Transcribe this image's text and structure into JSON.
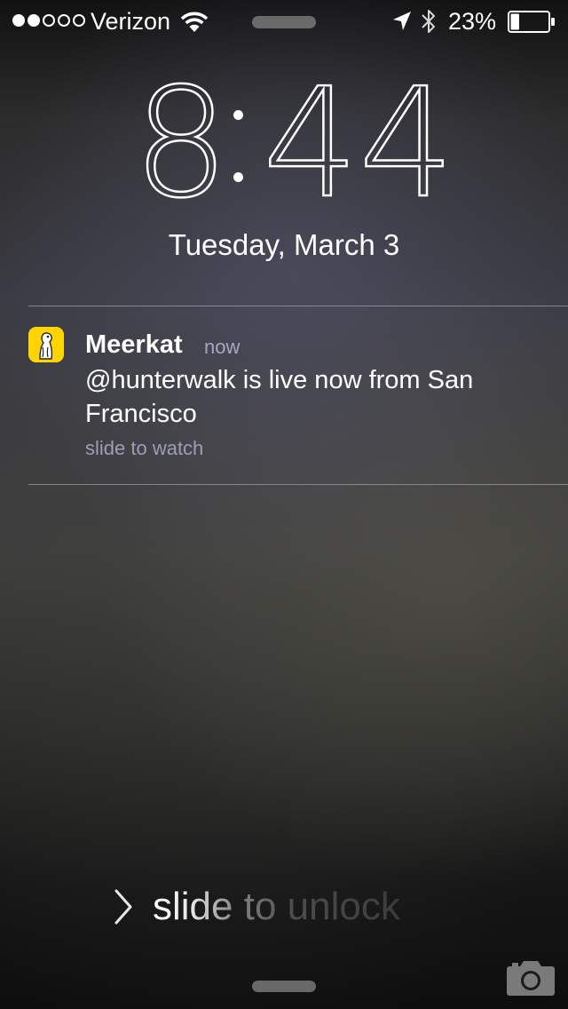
{
  "status_bar": {
    "signal_bars_filled": 2,
    "signal_bars_total": 5,
    "carrier": "Verizon",
    "battery_percent": "23%",
    "battery_level": 0.23,
    "icons": [
      "wifi-icon",
      "location-arrow-icon",
      "bluetooth-icon",
      "battery-icon"
    ]
  },
  "lock_screen": {
    "time_hours": "8",
    "time_minutes": "44",
    "date": "Tuesday, March 3"
  },
  "notification": {
    "app_name": "Meerkat",
    "time": "now",
    "message": "@hunterwalk is live now from San Francisco",
    "action_hint": "slide to watch",
    "app_icon": "meerkat-app-icon",
    "app_icon_color": "#FFD400"
  },
  "unlock": {
    "label": "slide to unlock",
    "icon": "chevron-right-icon"
  },
  "bottom": {
    "icons": [
      "camera-icon"
    ]
  }
}
